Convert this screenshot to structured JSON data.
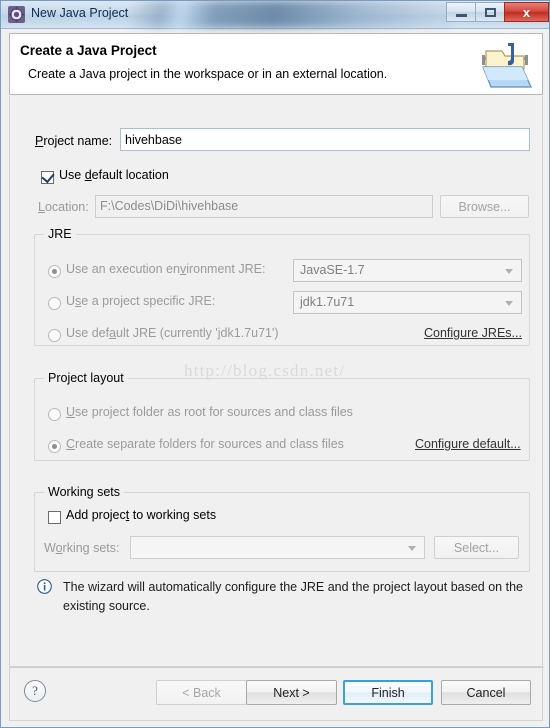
{
  "window": {
    "title": "New Java Project",
    "icon": "eclipse-wizard-icon",
    "minimize_label": "",
    "maximize_label": "",
    "close_label": "x"
  },
  "header": {
    "title": "Create a Java Project",
    "subtitle": "Create a Java project in the workspace or in an external location.",
    "icon": "java-project-folder-icon"
  },
  "form": {
    "project_name_label": "Project name:",
    "project_name_value": "hivehbase",
    "use_default_location_label": "Use default location",
    "use_default_location_checked": true,
    "location_label": "Location:",
    "location_value": "F:\\Codes\\DiDi\\hivehbase",
    "browse_label": "Browse..."
  },
  "jre": {
    "group_title": "JRE",
    "options": [
      {
        "label": "Use an execution environment JRE:",
        "selected": true
      },
      {
        "label": "Use a project specific JRE:",
        "selected": false
      },
      {
        "label": "Use default JRE (currently 'jdk1.7u71')",
        "selected": false
      }
    ],
    "execution_environment_value": "JavaSE-1.7",
    "project_jre_value": "jdk1.7u71",
    "configure_link": "Configure JREs..."
  },
  "project_layout": {
    "group_title": "Project layout",
    "options": [
      {
        "label": "Use project folder as root for sources and class files",
        "selected": false
      },
      {
        "label": "Create separate folders for sources and class files",
        "selected": true
      }
    ],
    "configure_link": "Configure default..."
  },
  "working_sets": {
    "group_title": "Working sets",
    "add_label": "Add project to working sets",
    "add_checked": false,
    "working_sets_label": "Working sets:",
    "working_sets_value": "",
    "select_label": "Select..."
  },
  "message": {
    "icon": "info-icon",
    "text": "The wizard will automatically configure the JRE and the project layout based on the existing source."
  },
  "footer": {
    "help_label": "?",
    "back_label": "< Back",
    "next_label": "Next >",
    "finish_label": "Finish",
    "cancel_label": "Cancel"
  },
  "watermark": {
    "text": "http://blog.csdn.net/"
  },
  "colors": {
    "accent": "#3d9fd8",
    "title_text": "#0b2d52",
    "close_button": "#d2453a",
    "link": "#333333"
  }
}
